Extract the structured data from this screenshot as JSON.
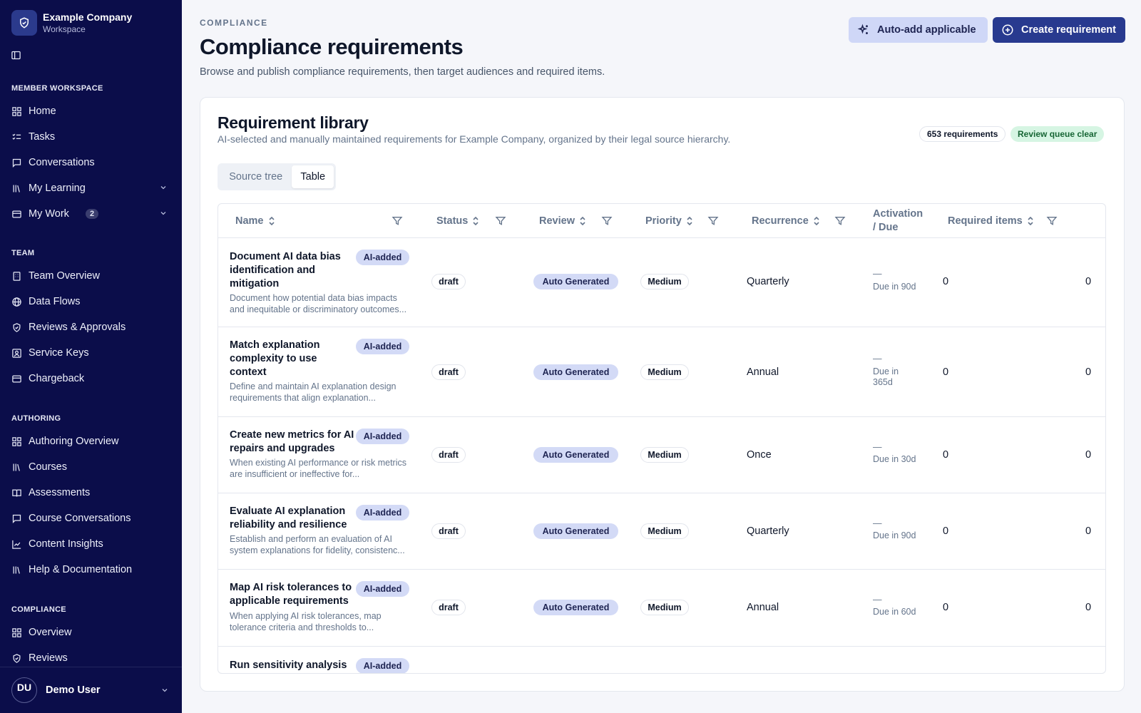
{
  "brand": {
    "name": "Example Company",
    "sub": "Workspace"
  },
  "sidebar": {
    "member_title": "MEMBER WORKSPACE",
    "member_items": [
      {
        "label": "Home",
        "icon": "grid-icon"
      },
      {
        "label": "Tasks",
        "icon": "checklist-icon"
      },
      {
        "label": "Conversations",
        "icon": "chat-icon"
      },
      {
        "label": "My Learning",
        "icon": "library-icon"
      },
      {
        "label": "My Work",
        "icon": "wallet-icon",
        "badge": "2"
      }
    ],
    "team_title": "TEAM",
    "team_items": [
      {
        "label": "Team Overview"
      },
      {
        "label": "Data Flows"
      },
      {
        "label": "Reviews & Approvals"
      },
      {
        "label": "Service Keys"
      },
      {
        "label": "Chargeback"
      }
    ],
    "authoring_title": "AUTHORING",
    "authoring_items": [
      {
        "label": "Authoring Overview"
      },
      {
        "label": "Courses"
      },
      {
        "label": "Assessments"
      },
      {
        "label": "Course Conversations"
      },
      {
        "label": "Content Insights"
      },
      {
        "label": "Help & Documentation"
      }
    ],
    "compliance_title": "COMPLIANCE",
    "compliance_items": [
      {
        "label": "Overview"
      },
      {
        "label": "Reviews"
      }
    ]
  },
  "user": {
    "initials": "DU",
    "name": "Demo User"
  },
  "header": {
    "eyebrow": "COMPLIANCE",
    "title": "Compliance requirements",
    "description": "Browse and publish compliance requirements, then target audiences and required items.",
    "auto_add_label": "Auto-add applicable",
    "create_label": "Create requirement"
  },
  "library": {
    "title": "Requirement library",
    "subtitle": "AI-selected and manually maintained requirements for Example Company, organized by their legal source hierarchy.",
    "count_label": "653 requirements",
    "queue_label": "Review queue clear",
    "view_tabs": {
      "source_tree": "Source tree",
      "table": "Table"
    }
  },
  "table": {
    "columns": {
      "name": "Name",
      "status": "Status",
      "review": "Review",
      "priority": "Priority",
      "recurrence": "Recurrence",
      "activation_line1": "Activation",
      "activation_line2": "/ Due",
      "required_items": "Required items"
    },
    "rows": [
      {
        "name": "Document AI data bias identification and mitigation",
        "badge": "AI-added",
        "description": "Document how potential data bias impacts and inequitable or discriminatory outcomes...",
        "status": "draft",
        "review": "Auto Generated",
        "priority": "Medium",
        "recurrence": "Quarterly",
        "activation": "—",
        "due": "Due in 90d",
        "required_items": "0",
        "edge": "0"
      },
      {
        "name": "Match explanation complexity to use context",
        "badge": "AI-added",
        "description": "Define and maintain AI explanation design requirements that align explanation...",
        "status": "draft",
        "review": "Auto Generated",
        "priority": "Medium",
        "recurrence": "Annual",
        "activation": "—",
        "due": "Due in 365d",
        "required_items": "0",
        "edge": "0"
      },
      {
        "name": "Create new metrics for AI repairs and upgrades",
        "badge": "AI-added",
        "description": "When existing AI performance or risk metrics are insufficient or ineffective for...",
        "status": "draft",
        "review": "Auto Generated",
        "priority": "Medium",
        "recurrence": "Once",
        "activation": "—",
        "due": "Due in 30d",
        "required_items": "0",
        "edge": "0"
      },
      {
        "name": "Evaluate AI explanation reliability and resilience",
        "badge": "AI-added",
        "description": "Establish and perform an evaluation of AI system explanations for fidelity, consistenc...",
        "status": "draft",
        "review": "Auto Generated",
        "priority": "Medium",
        "recurrence": "Quarterly",
        "activation": "—",
        "due": "Due in 90d",
        "required_items": "0",
        "edge": "0"
      },
      {
        "name": "Map AI risk tolerances to applicable requirements",
        "badge": "AI-added",
        "description": "When applying AI risk tolerances, map tolerance criteria and thresholds to...",
        "status": "draft",
        "review": "Auto Generated",
        "priority": "Medium",
        "recurrence": "Annual",
        "activation": "—",
        "due": "Due in 60d",
        "required_items": "0",
        "edge": "0"
      },
      {
        "name": "Run sensitivity analysis",
        "badge": "AI-added"
      }
    ]
  },
  "colors": {
    "sidebar": "#0b0d4a",
    "primary": "#283a8f",
    "accent_soft": "#d3daf6",
    "success_soft": "#d6f5e3"
  }
}
